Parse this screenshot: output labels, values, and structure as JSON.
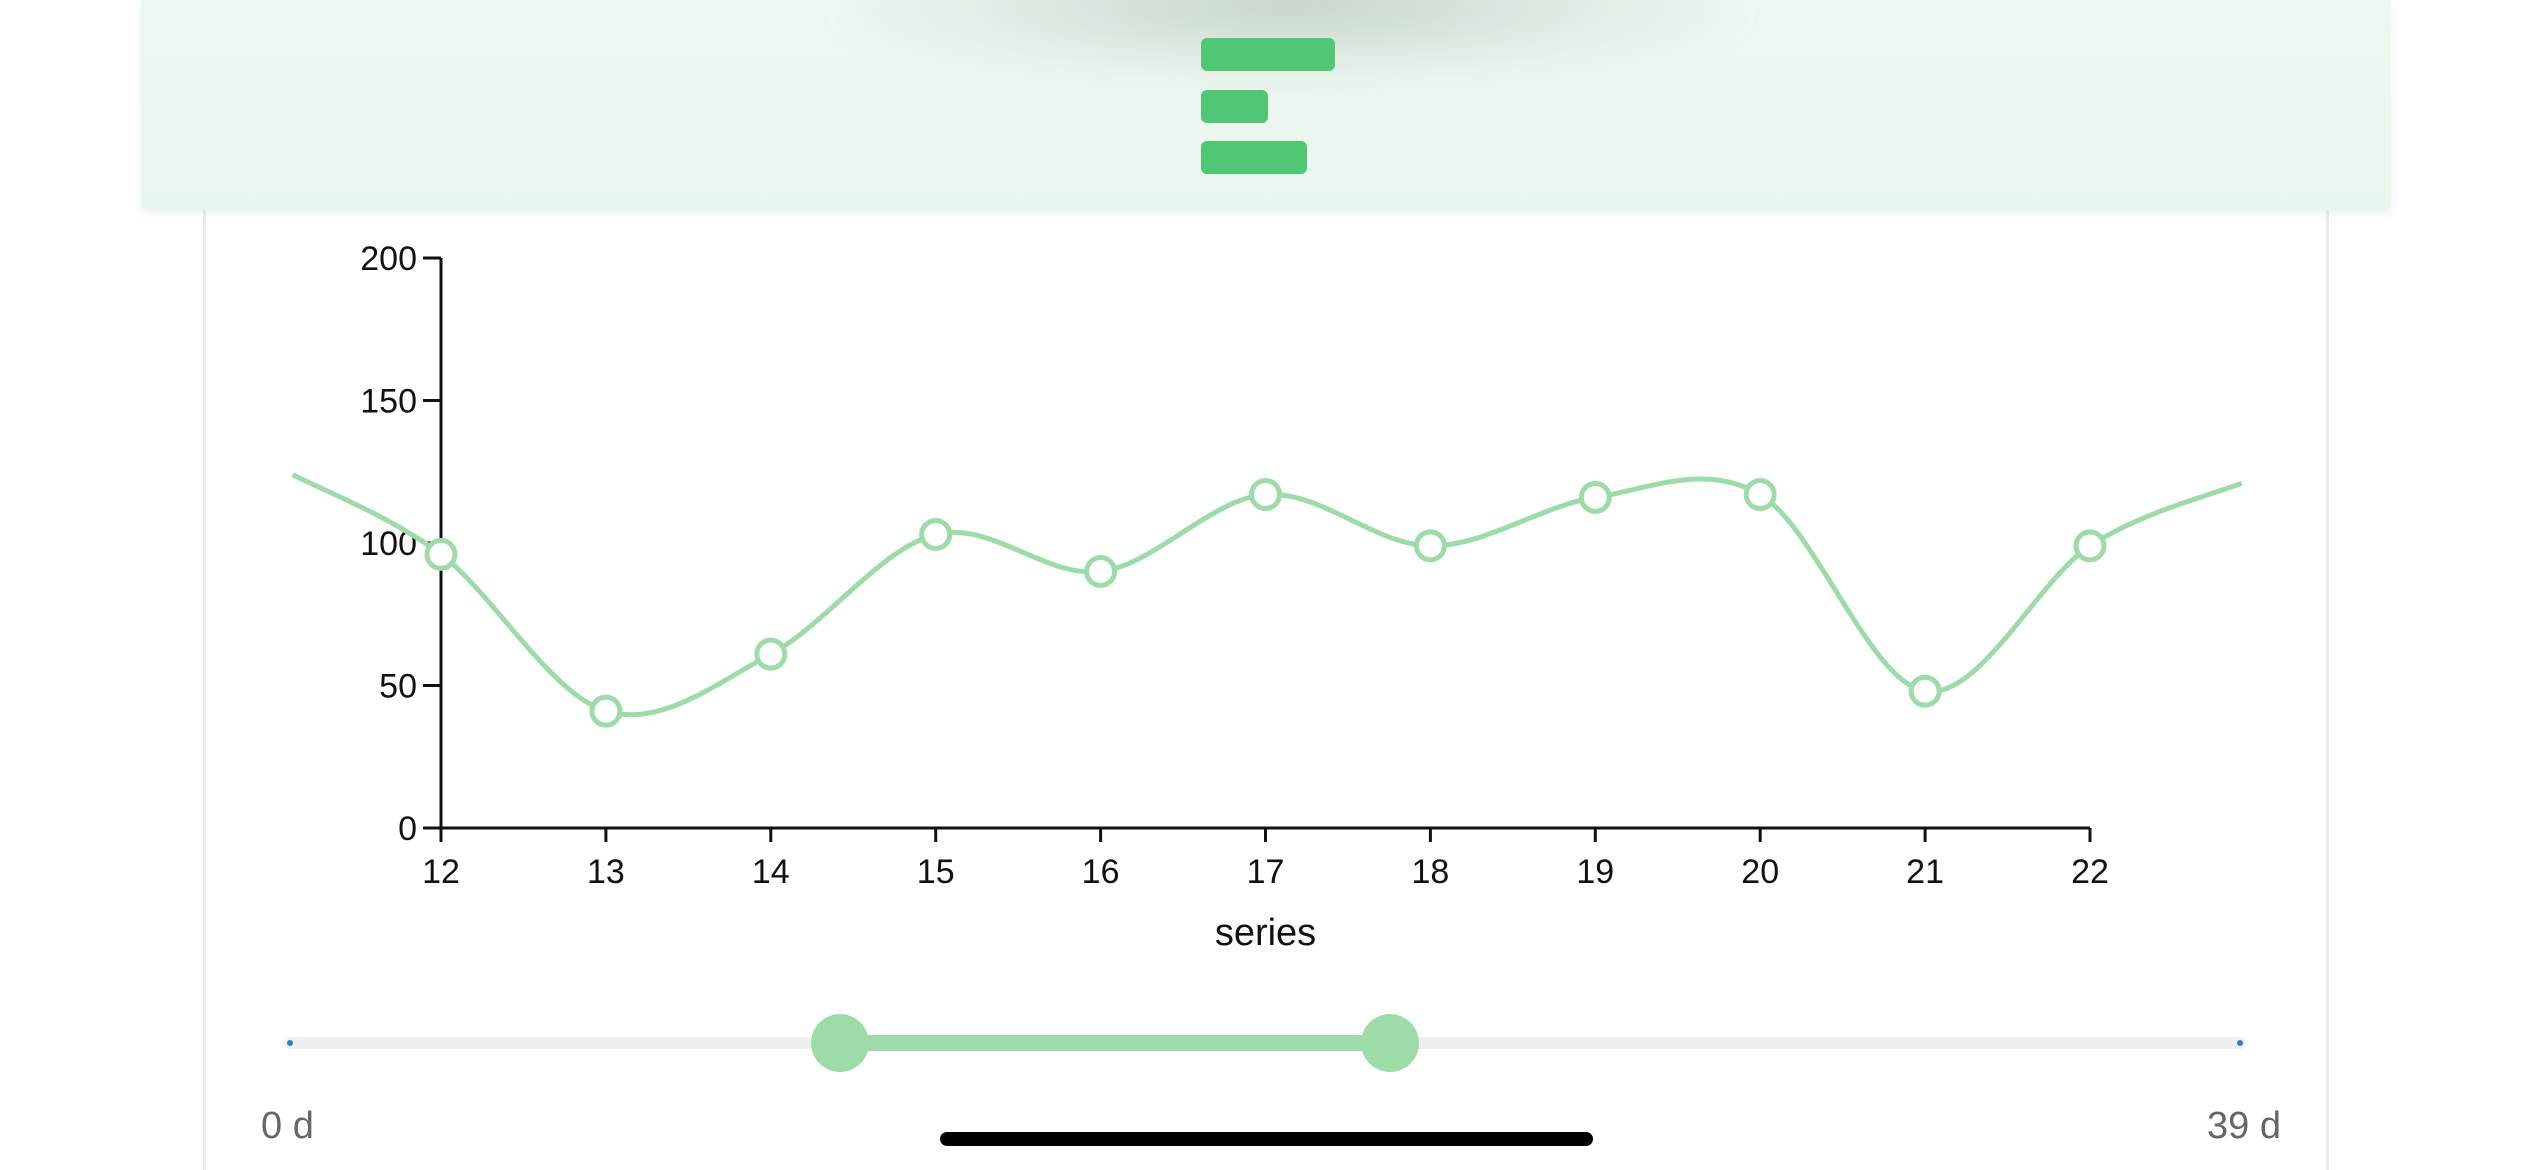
{
  "chart_data": {
    "type": "line",
    "x": [
      12,
      13,
      14,
      15,
      16,
      17,
      18,
      19,
      20,
      21,
      22
    ],
    "values": [
      96,
      41,
      61,
      103,
      90,
      117,
      99,
      116,
      117,
      48,
      99
    ],
    "series": [
      {
        "values": [
          96,
          41,
          61,
          103,
          90,
          117,
          99,
          116,
          117,
          48,
          99
        ]
      }
    ],
    "xlabel": "series",
    "ylabel": "",
    "xlim": [
      12,
      22
    ],
    "ylim": [
      0,
      200
    ],
    "yticks": [
      0,
      50,
      100,
      150,
      200
    ],
    "xticks": [
      12,
      13,
      14,
      15,
      16,
      17,
      18,
      19,
      20,
      21,
      22
    ],
    "curve": "smooth",
    "line_extends_beyond_axes": true,
    "grid": false,
    "color": "#9ddca9"
  },
  "range_slider": {
    "min_label": "0 d",
    "max_label": "39 d",
    "min_value": 0,
    "max_value": 39,
    "selected_start": 11,
    "selected_end": 22,
    "track_color": "#efefef",
    "fill_color": "#9ddca9"
  },
  "brand": {
    "logo_icon": "stacked-bars-logo-icon",
    "accent_color": "#4fc774"
  }
}
